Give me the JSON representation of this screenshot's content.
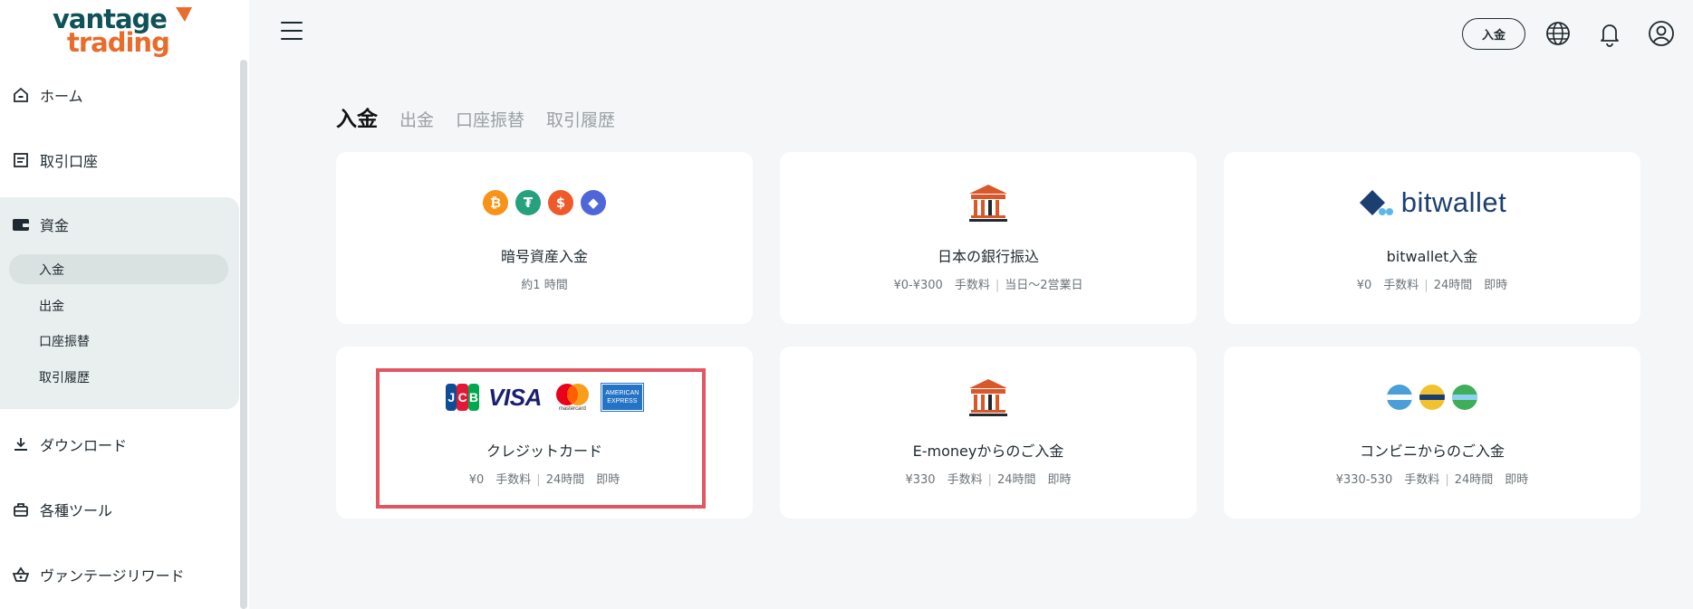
{
  "logo": {
    "line1": "vantage",
    "line2": "trading"
  },
  "sidebar": {
    "items": [
      {
        "label": "ホーム",
        "icon": "home-icon"
      },
      {
        "label": "取引口座",
        "icon": "account-icon"
      },
      {
        "label": "資金",
        "icon": "wallet-icon"
      },
      {
        "label": "ダウンロード",
        "icon": "download-icon"
      },
      {
        "label": "各種ツール",
        "icon": "toolbox-icon"
      },
      {
        "label": "ヴァンテージリワード",
        "icon": "basket-icon"
      }
    ],
    "fund_sub": [
      {
        "label": "入金",
        "active": true
      },
      {
        "label": "出金"
      },
      {
        "label": "口座振替"
      },
      {
        "label": "取引履歴"
      }
    ]
  },
  "header": {
    "deposit_button": "入金",
    "icons": [
      "globe-icon",
      "bell-icon",
      "user-icon"
    ]
  },
  "tabs": [
    "入金",
    "出金",
    "口座振替",
    "取引履歴"
  ],
  "cards": [
    {
      "title": "暗号資産入金",
      "meta": [
        "約1 時間"
      ]
    },
    {
      "title": "日本の銀行振込",
      "meta": [
        "¥0-¥300　手数料",
        "当日～2営業日"
      ]
    },
    {
      "title": "bitwallet入金",
      "logo_text": "bitwallet",
      "meta": [
        "¥0　手数料",
        "24時間　即時"
      ]
    },
    {
      "title": "クレジットカード",
      "meta": [
        "¥0　手数料",
        "24時間　即時"
      ],
      "brands": {
        "jcb": [
          "J",
          "C",
          "B"
        ],
        "visa": "VISA",
        "mastercard": "mastercard",
        "amex": [
          "AMERICAN",
          "EXPRESS"
        ]
      }
    },
    {
      "title": "E-moneyからのご入金",
      "meta": [
        "¥330　手数料",
        "24時間　即時"
      ]
    },
    {
      "title": "コンビニからのご入金",
      "meta": [
        "¥330-530　手数料",
        "24時間　即時"
      ]
    }
  ],
  "colors": {
    "accent": "#e86c2c",
    "brand_dark": "#0f5257",
    "highlight": "#e25662",
    "bank_icon": "#d9582b"
  }
}
